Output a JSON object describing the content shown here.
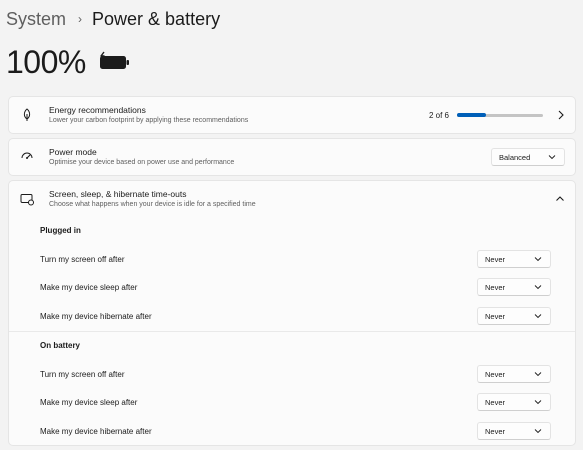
{
  "breadcrumb": {
    "parent": "System",
    "separator": "›",
    "current": "Power & battery"
  },
  "battery": {
    "percent_text": "100%",
    "icon": "battery-full-charging-icon"
  },
  "energy": {
    "title": "Energy recommendations",
    "subtitle": "Lower your carbon footprint by applying these recommendations",
    "progress_text": "2 of 6",
    "progress_fraction": 0.333,
    "icon": "leaf-icon"
  },
  "power_mode": {
    "title": "Power mode",
    "subtitle": "Optimise your device based on power use and performance",
    "value": "Balanced",
    "icon": "power-mode-icon"
  },
  "timeouts": {
    "title": "Screen, sleep, & hibernate time-outs",
    "subtitle": "Choose what happens when your device is idle for a specified time",
    "icon": "screen-sleep-icon",
    "plugged_in": {
      "heading": "Plugged in",
      "settings": [
        {
          "label": "Turn my screen off after",
          "value": "Never"
        },
        {
          "label": "Make my device sleep after",
          "value": "Never"
        },
        {
          "label": "Make my device hibernate after",
          "value": "Never"
        }
      ]
    },
    "on_battery": {
      "heading": "On battery",
      "settings": [
        {
          "label": "Turn my screen off after",
          "value": "Never"
        },
        {
          "label": "Make my device sleep after",
          "value": "Never"
        },
        {
          "label": "Make my device hibernate after",
          "value": "Never"
        }
      ]
    }
  },
  "colors": {
    "accent": "#005fb8",
    "background": "#f3f3f3",
    "card": "#fbfbfb"
  }
}
